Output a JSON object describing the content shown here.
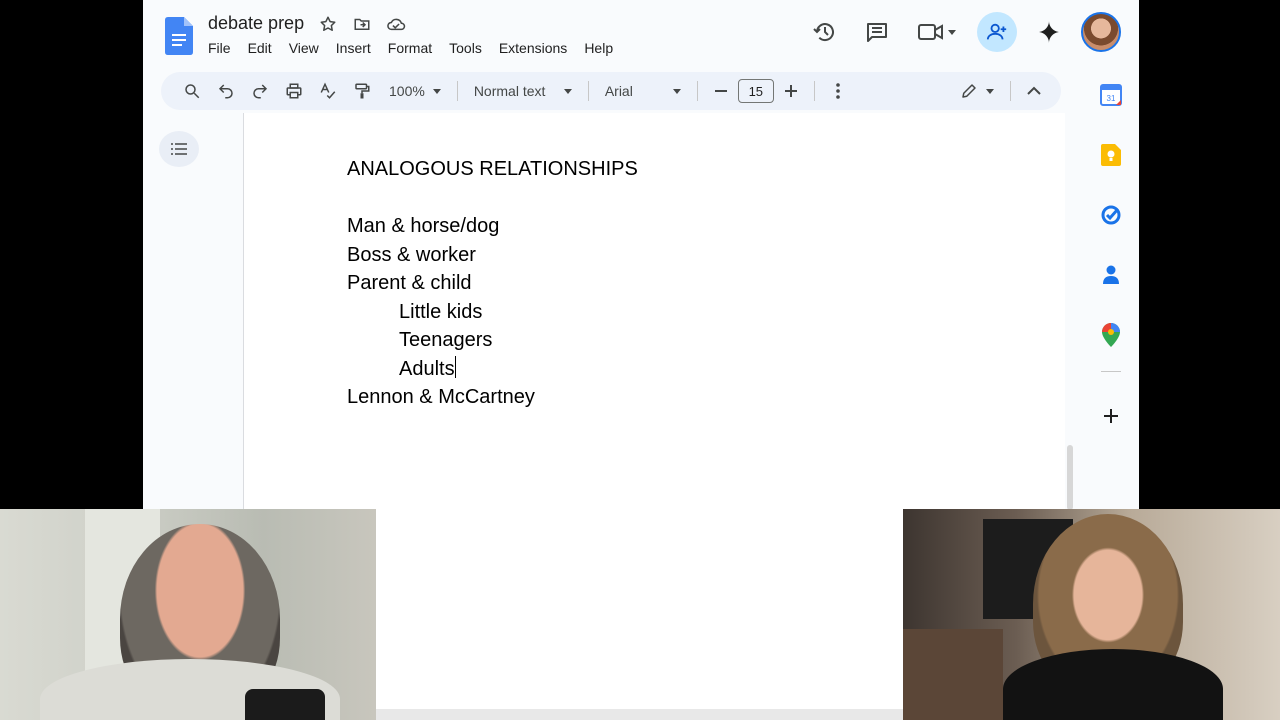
{
  "doc": {
    "title": "debate prep",
    "menu": [
      "File",
      "Edit",
      "View",
      "Insert",
      "Format",
      "Tools",
      "Extensions",
      "Help"
    ]
  },
  "toolbar": {
    "zoom": "100%",
    "style": "Normal text",
    "font": "Arial",
    "font_size": "15"
  },
  "content": {
    "heading": "ANALOGOUS RELATIONSHIPS",
    "lines": [
      "Man & horse/dog",
      "Boss & worker",
      "Parent & child"
    ],
    "sub_lines": [
      "Little kids",
      "Teenagers",
      "Adults"
    ],
    "last_line": "Lennon & McCartney"
  },
  "colors": {
    "docs_blue": "#4285f4",
    "share_bg": "#c2e7ff",
    "toolbar_bg": "#edf2fa"
  },
  "icons": {
    "title": [
      "star-icon",
      "move-folder-icon",
      "cloud-saved-icon"
    ],
    "actions": [
      "history-icon",
      "comments-icon",
      "meet-icon",
      "share-icon",
      "gemini-icon"
    ],
    "side_panel": [
      "calendar-icon",
      "keep-icon",
      "tasks-icon",
      "contacts-icon",
      "maps-icon",
      "add-icon"
    ]
  }
}
